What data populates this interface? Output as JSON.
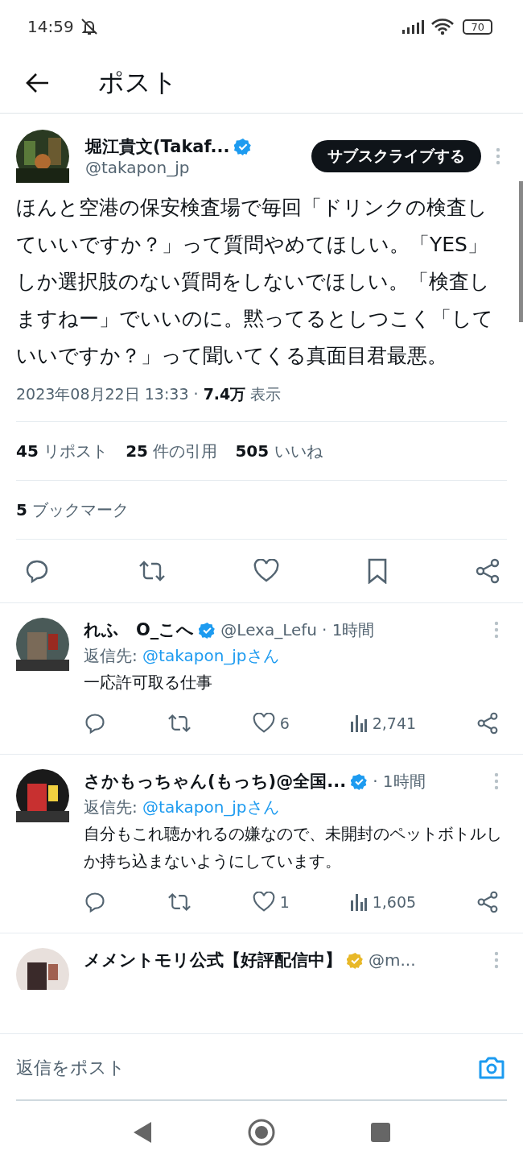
{
  "status_bar": {
    "time": "14:59",
    "battery": "70"
  },
  "header": {
    "title": "ポスト"
  },
  "post": {
    "author": {
      "name": "堀江貴文(Takaf...",
      "handle": "@takapon_jp",
      "badge": {
        "color": "#1d9bf0"
      }
    },
    "subscribe_button": "サブスクライブする",
    "text": "ほんと空港の保安検査場で毎回「ドリンクの検査していいですか？」って質問やめてほしい。「YES」しか選択肢のない質問をしないでほしい。「検査しますねー」でいいのに。黙ってるとしつこく「していいですか？」って聞いてくる真面目君最悪。",
    "timestamp": "2023年08月22日 13:33 · ",
    "views": "7.4万",
    "views_label": "表示",
    "stats": [
      {
        "count": "45",
        "label": "リポスト"
      },
      {
        "count": "25",
        "label": "件の引用"
      },
      {
        "count": "505",
        "label": "いいね"
      }
    ],
    "bookmarks": {
      "count": "5",
      "label": "ブックマーク"
    }
  },
  "replies": [
    {
      "name": "れふ　O_こへ",
      "badge": {
        "color": "#1d9bf0"
      },
      "handle": "@Lexa_Lefu",
      "time": "· 1時間",
      "reply_to_label": "返信先:",
      "reply_to": "@takapon_jpさん",
      "text": "一応許可取る仕事",
      "likes": "6",
      "views": "2,741"
    },
    {
      "name": "さかもっちゃん(もっち)@全国...",
      "badge": {
        "color": "#1d9bf0"
      },
      "time": "· 1時間",
      "reply_to_label": "返信先:",
      "reply_to": "@takapon_jpさん",
      "text": "自分もこれ聴かれるの嫌なので、未開封のペットボトルしか持ち込まないようにしています。",
      "likes": "1",
      "views": "1,605"
    },
    {
      "name": "メメントモリ公式【好評配信中】",
      "badge": {
        "color": "#e8b828"
      },
      "handle": "@m..."
    }
  ],
  "reply_bar": {
    "placeholder": "返信をポスト"
  }
}
